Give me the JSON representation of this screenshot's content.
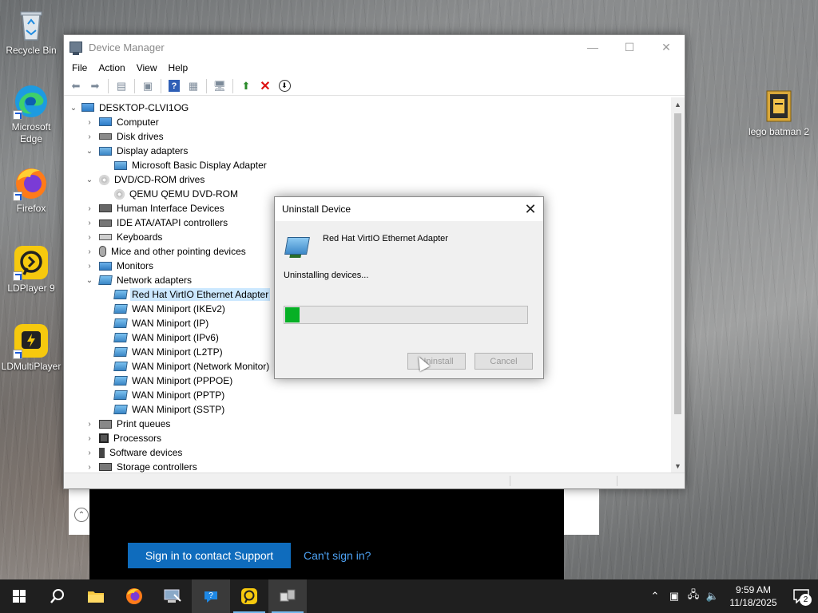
{
  "desktop": {
    "icons": [
      {
        "label": "Recycle Bin"
      },
      {
        "label": "Microsoft Edge"
      },
      {
        "label": "Firefox"
      },
      {
        "label": "LDPlayer 9"
      },
      {
        "label": "LDMultiPlayer"
      },
      {
        "label": "lego batman 2"
      }
    ]
  },
  "background_window": {
    "support_button": "Sign in to contact Support",
    "cant_sign_in": "Can't sign in?"
  },
  "device_manager": {
    "title": "Device Manager",
    "menu": [
      "File",
      "Action",
      "View",
      "Help"
    ],
    "tree": {
      "root": "DESKTOP-CLVI1OG",
      "items": [
        {
          "label": "Computer",
          "level": 1,
          "expanded": false
        },
        {
          "label": "Disk drives",
          "level": 1,
          "expanded": false
        },
        {
          "label": "Display adapters",
          "level": 1,
          "expanded": true
        },
        {
          "label": "Microsoft Basic Display Adapter",
          "level": 2
        },
        {
          "label": "DVD/CD-ROM drives",
          "level": 1,
          "expanded": true
        },
        {
          "label": "QEMU QEMU DVD-ROM",
          "level": 2
        },
        {
          "label": "Human Interface Devices",
          "level": 1,
          "expanded": false
        },
        {
          "label": "IDE ATA/ATAPI controllers",
          "level": 1,
          "expanded": false
        },
        {
          "label": "Keyboards",
          "level": 1,
          "expanded": false
        },
        {
          "label": "Mice and other pointing devices",
          "level": 1,
          "expanded": false
        },
        {
          "label": "Monitors",
          "level": 1,
          "expanded": false
        },
        {
          "label": "Network adapters",
          "level": 1,
          "expanded": true
        },
        {
          "label": "Red Hat VirtIO Ethernet Adapter",
          "level": 2,
          "selected": true
        },
        {
          "label": "WAN Miniport (IKEv2)",
          "level": 2
        },
        {
          "label": "WAN Miniport (IP)",
          "level": 2
        },
        {
          "label": "WAN Miniport (IPv6)",
          "level": 2
        },
        {
          "label": "WAN Miniport (L2TP)",
          "level": 2
        },
        {
          "label": "WAN Miniport (Network Monitor)",
          "level": 2
        },
        {
          "label": "WAN Miniport (PPPOE)",
          "level": 2
        },
        {
          "label": "WAN Miniport (PPTP)",
          "level": 2
        },
        {
          "label": "WAN Miniport (SSTP)",
          "level": 2
        },
        {
          "label": "Print queues",
          "level": 1,
          "expanded": false
        },
        {
          "label": "Processors",
          "level": 1,
          "expanded": false
        },
        {
          "label": "Software devices",
          "level": 1,
          "expanded": false
        },
        {
          "label": "Storage controllers",
          "level": 1,
          "expanded": false
        }
      ]
    }
  },
  "uninstall_dialog": {
    "title": "Uninstall Device",
    "device_name": "Red Hat VirtIO Ethernet Adapter",
    "status": "Uninstalling devices...",
    "progress": 0.06,
    "progress_color": "#06b025",
    "uninstall_label": "Uninstall",
    "cancel_label": "Cancel"
  },
  "taskbar": {
    "time": "9:59 AM",
    "date": "11/18/2025",
    "notification_count": "2"
  }
}
